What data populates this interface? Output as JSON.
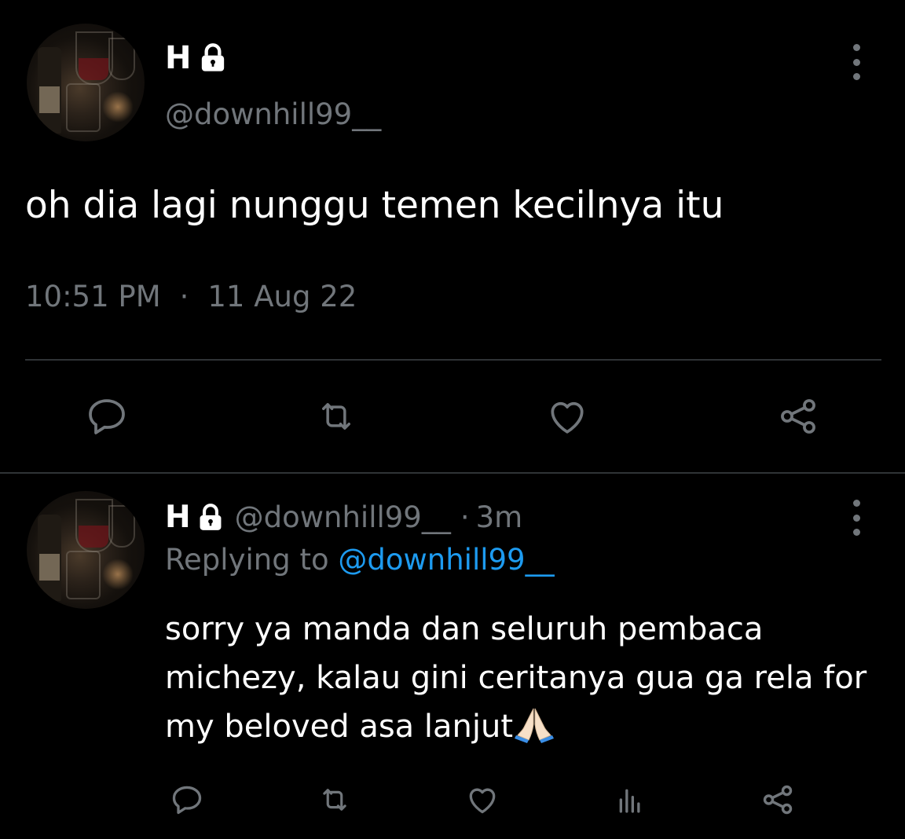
{
  "main_tweet": {
    "author_name": "H",
    "lock_icon": "lock-icon",
    "handle": "@downhill99__",
    "text": "oh dia lagi nunggu temen kecilnya itu",
    "time": "10:51 PM",
    "separator": "·",
    "date": "11 Aug 22",
    "actions": [
      "reply-icon",
      "retweet-icon",
      "like-icon",
      "share-icon"
    ]
  },
  "reply_tweet": {
    "author_name": "H",
    "lock_icon": "lock-icon",
    "handle": "@downhill99__",
    "separator": "·",
    "age": "3m",
    "replying_prefix": "Replying to",
    "replying_mention": "@downhill99__",
    "text": "sorry ya manda dan seluruh pembaca michezy, kalau gini ceritanya gua ga rela for my beloved asa lanjut",
    "emoji": "folded-hands-emoji",
    "actions": [
      "reply-icon",
      "retweet-icon",
      "like-icon",
      "analytics-icon",
      "share-icon"
    ]
  },
  "colors": {
    "background": "#000000",
    "text_primary": "#ffffff",
    "text_secondary": "#71767b",
    "link": "#1d9bf0",
    "divider": "#2f3336"
  }
}
